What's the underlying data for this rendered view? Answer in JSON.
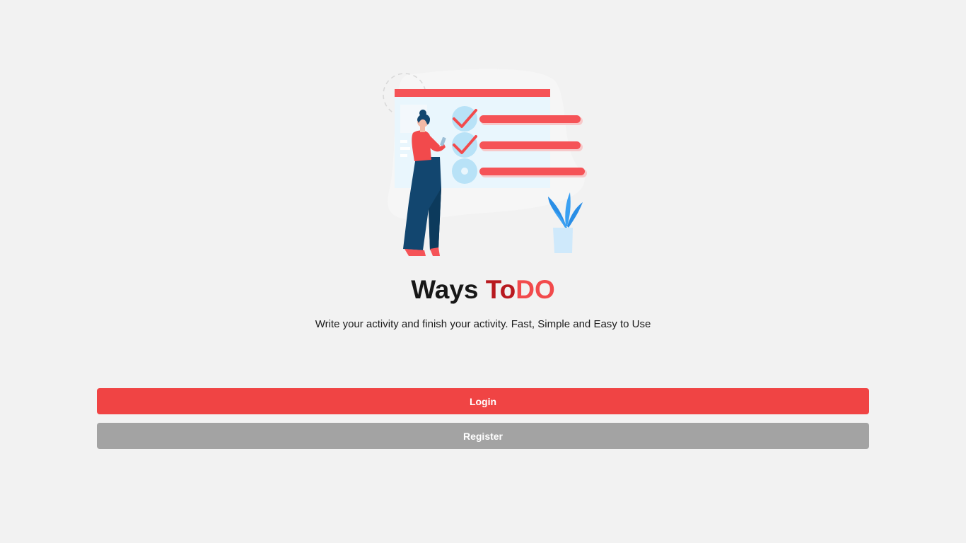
{
  "app": {
    "brand_part1": "Ways",
    "brand_part2": "To",
    "brand_part3": "DO",
    "tagline": "Write your activity and finish your activity. Fast, Simple and Easy to Use"
  },
  "actions": {
    "login_label": "Login",
    "register_label": "Register"
  },
  "colors": {
    "background": "#f2f2f2",
    "brand_dark_red": "#b8191f",
    "brand_red": "#f24a4c",
    "login_button": "#f04444",
    "register_button": "#a3a3a3"
  },
  "illustration": {
    "icon": "todo-checklist-illustration",
    "checked_items": 2,
    "total_items": 3
  }
}
